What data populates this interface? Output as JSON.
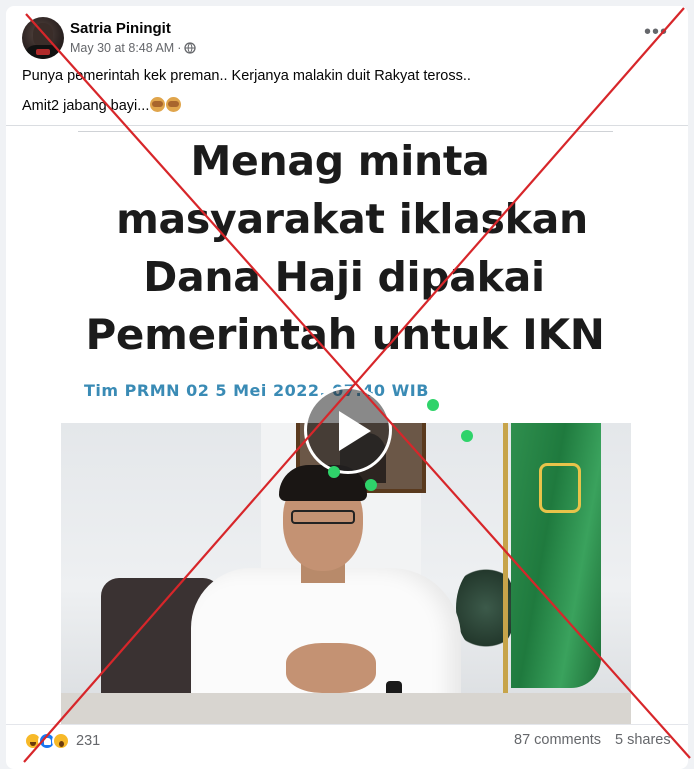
{
  "post": {
    "author": "Satria Piningit",
    "timestamp": "May 30 at 8:48 AM",
    "separator": "·",
    "privacy_icon": "globe-icon",
    "more_icon": "•••",
    "caption_line1": "Punya pemerintah kek preman.. Kerjanya malakin duit Rakyat teross..",
    "caption_line2": "Amit2 jabang bayi...",
    "caption_emojis": [
      "see-no-evil-monkey-icon",
      "see-no-evil-monkey-icon"
    ]
  },
  "media": {
    "headline_line1": "Menag minta",
    "headline_line2": "masyarakat iklaskan",
    "headline_line3": "Dana Haji dipakai",
    "headline_line4": "Pemerintah untuk IKN",
    "byline": "Tim PRMN 02 5 Mei 2022, 07:40 WIB",
    "play_icon": "play-icon"
  },
  "footer": {
    "reaction_icons": [
      "haha-icon",
      "like-icon",
      "wow-icon"
    ],
    "reaction_count": "231",
    "comments": "87 comments",
    "shares": "5 shares"
  },
  "overlay": {
    "cross_color": "#d7262a"
  },
  "colors": {
    "background": "#f0f2f5",
    "card": "#ffffff",
    "text_primary": "#050505",
    "text_secondary": "#65676b",
    "byline_blue": "#3a8bb5",
    "green_marker": "#2fd36a"
  }
}
